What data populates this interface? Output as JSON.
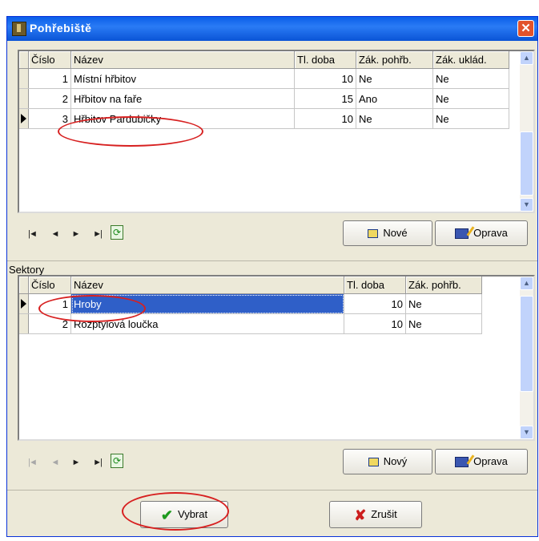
{
  "window": {
    "title": "Pohřebiště",
    "close_glyph": "✕",
    "title_icon": "tombstone-icon"
  },
  "cemeteries": {
    "columns": [
      "Číslo",
      "Název",
      "Tl. doba",
      "Zák. pohřb.",
      "Zák. uklád."
    ],
    "rows": [
      [
        "1",
        "Místní hřbitov",
        "10",
        "Ne",
        "Ne"
      ],
      [
        "2",
        "Hřbitov na faře",
        "15",
        "Ano",
        "Ne"
      ],
      [
        "3",
        "Hřbitov Pardubičky",
        "10",
        "Ne",
        "Ne"
      ]
    ],
    "current_row": 3
  },
  "navigator_top": {
    "first": "|◄",
    "prev": "◄",
    "next": "►",
    "last": "►|",
    "refresh": "⟳"
  },
  "buttons_top": {
    "new_label": "Nové",
    "edit_label": "Oprava"
  },
  "sectors_label": "Sektory",
  "sectors": {
    "columns": [
      "Číslo",
      "Název",
      "Tl. doba",
      "Zák. pohřb."
    ],
    "rows": [
      [
        "1",
        "Hroby",
        "10",
        "Ne"
      ],
      [
        "2",
        "Rozptylová loučka",
        "10",
        "Ne"
      ]
    ],
    "current_row": 1
  },
  "navigator_bottom": {
    "first": "|◄",
    "prev": "◄",
    "next": "►",
    "last": "►|",
    "refresh": "⟳"
  },
  "buttons_bottom": {
    "new_label": "Nový",
    "edit_label": "Oprava"
  },
  "footer": {
    "select_label": "Vybrat",
    "cancel_label": "Zrušit"
  },
  "scroll_arrows": {
    "up": "▲",
    "down": "▼"
  },
  "colors": {
    "title_bar": "#0a5ee8",
    "selection": "#2f5fc8",
    "highlight_ellipse": "#d72020"
  }
}
